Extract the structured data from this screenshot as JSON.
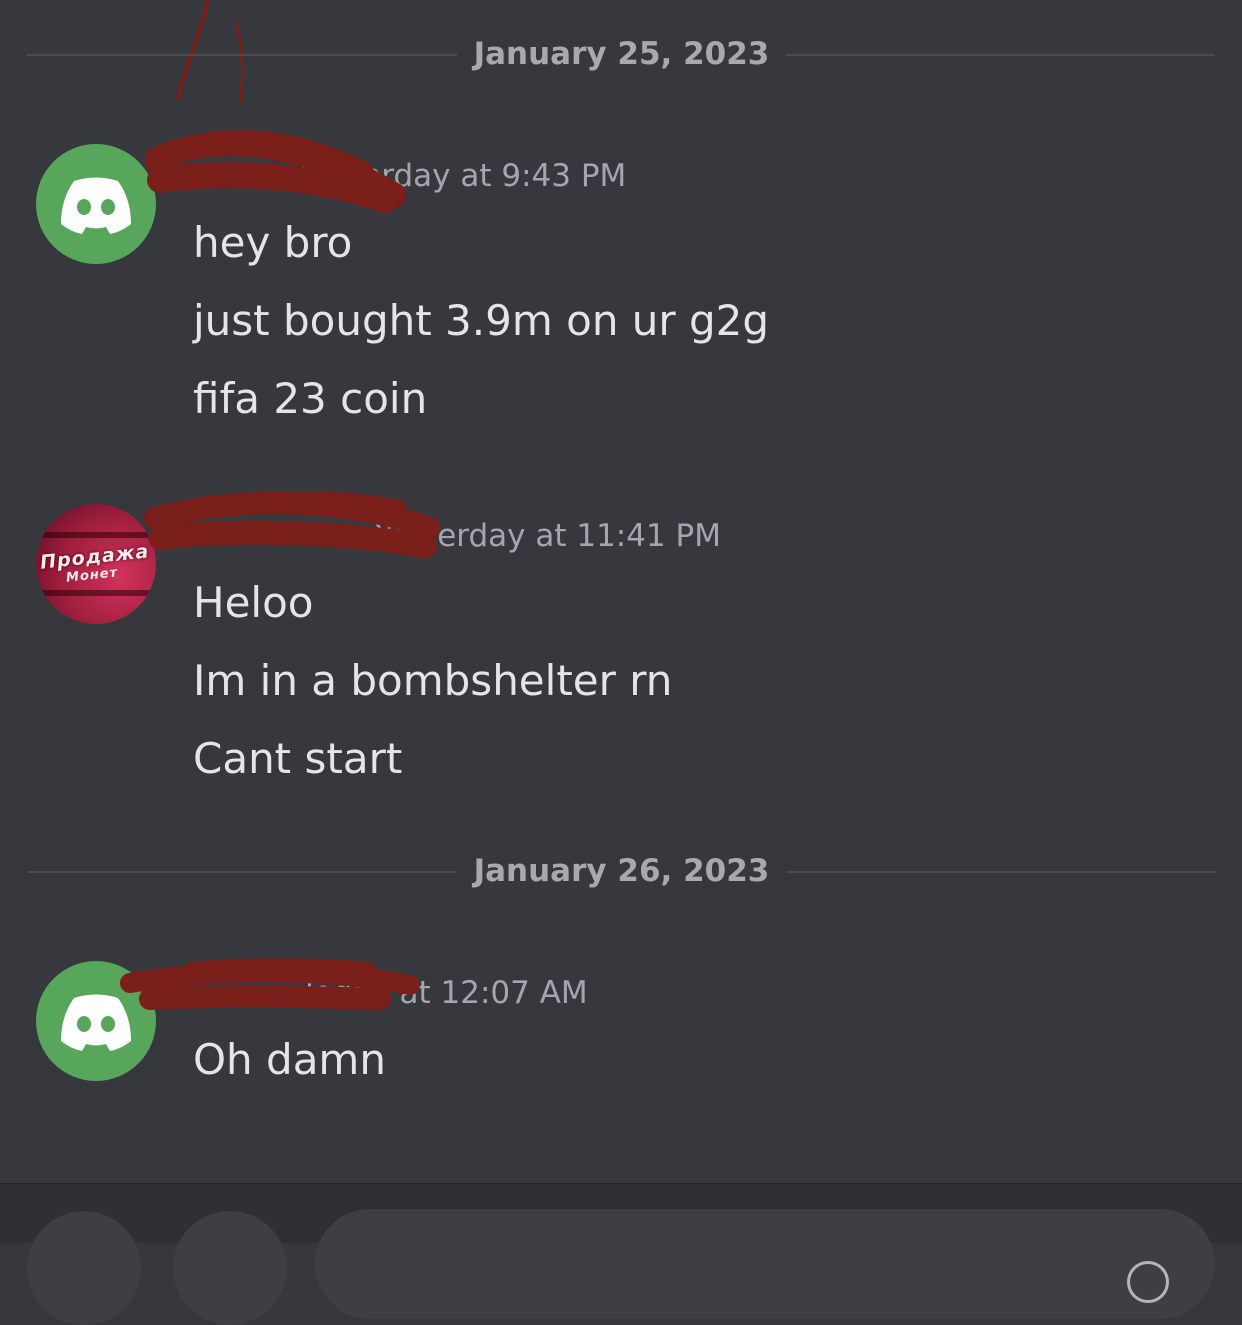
{
  "dates": [
    "January 25, 2023",
    "January 26, 2023"
  ],
  "messages": [
    {
      "avatar": "discord-default-avatar",
      "username": "",
      "timestamp": "Yesterday at 9:43 PM",
      "lines": [
        "hey bro",
        "just bought 3.9m on ur g2g",
        "fifa 23 coin"
      ]
    },
    {
      "avatar": "profile-photo-avatar",
      "avatar_text": [
        "Продажа",
        "Монет"
      ],
      "username": "",
      "timestamp": "Yesterday at 11:41 PM",
      "lines": [
        "Heloo",
        "Im in a bombshelter rn",
        "Cant start"
      ]
    },
    {
      "avatar": "discord-default-avatar",
      "username": "",
      "timestamp": "Today at 12:07 AM",
      "lines": [
        "Oh damn"
      ]
    }
  ],
  "colors": {
    "background": "#36383e",
    "avatar_green": "#58a55c",
    "redaction": "#7a1f1a",
    "message_text": "#e3e5e8",
    "timestamp_text": "#a3a6ac"
  },
  "composer": {
    "icons": [
      "plus-icon",
      "gift-icon",
      "emoji-icon"
    ]
  }
}
